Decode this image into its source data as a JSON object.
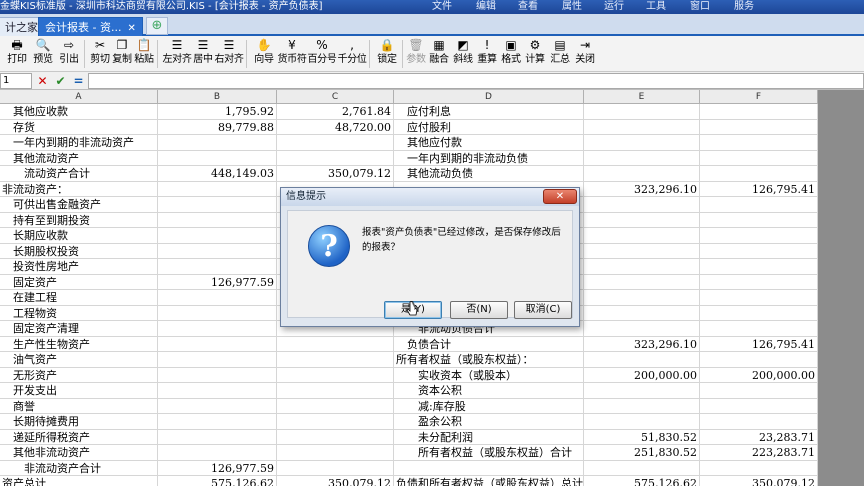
{
  "window": {
    "title": "金蝶KIS标准版 - 深圳市科达商贸有限公司.KIS - [会计报表 - 资产负债表]",
    "menus": [
      "文件",
      "编辑",
      "查看",
      "属性",
      "运行",
      "工具",
      "窗口",
      "服务"
    ]
  },
  "tabs": [
    {
      "label": "计之家",
      "active": false
    },
    {
      "label": "会计报表 - 资...",
      "active": true
    }
  ],
  "toolbar": [
    {
      "label": "打印",
      "icon": "printer-icon",
      "glyph": "🖶",
      "enabled": true
    },
    {
      "label": "预览",
      "icon": "preview-icon",
      "glyph": "🔍",
      "enabled": true
    },
    {
      "label": "引出",
      "icon": "export-icon",
      "glyph": "⇨",
      "enabled": true
    },
    {
      "label": "剪切",
      "icon": "scissors-icon",
      "glyph": "✂",
      "enabled": true
    },
    {
      "label": "复制",
      "icon": "copy-icon",
      "glyph": "❐",
      "enabled": true
    },
    {
      "label": "粘贴",
      "icon": "paste-icon",
      "glyph": "📋",
      "enabled": true
    },
    {
      "label": "左对齐",
      "icon": "align-left-icon",
      "glyph": "☰",
      "enabled": true
    },
    {
      "label": "居中",
      "icon": "align-center-icon",
      "glyph": "☰",
      "enabled": true
    },
    {
      "label": "右对齐",
      "icon": "align-right-icon",
      "glyph": "☰",
      "enabled": true
    },
    {
      "label": "向导",
      "icon": "wizard-icon",
      "glyph": "✋",
      "enabled": true
    },
    {
      "label": "货币符",
      "icon": "currency-icon",
      "glyph": "¥",
      "enabled": true
    },
    {
      "label": "百分号",
      "icon": "percent-icon",
      "glyph": "%",
      "enabled": true
    },
    {
      "label": "千分位",
      "icon": "thousands-icon",
      "glyph": ",",
      "enabled": true
    },
    {
      "label": "锁定",
      "icon": "lock-icon",
      "glyph": "🔒",
      "enabled": true
    },
    {
      "label": "参数",
      "icon": "trash-icon",
      "glyph": "🗑",
      "enabled": false
    },
    {
      "label": "融合",
      "icon": "merge-icon",
      "glyph": "▦",
      "enabled": true
    },
    {
      "label": "斜线",
      "icon": "diagonal-icon",
      "glyph": "◩",
      "enabled": true
    },
    {
      "label": "重算",
      "icon": "recalc-icon",
      "glyph": "!",
      "enabled": true
    },
    {
      "label": "格式",
      "icon": "format-icon",
      "glyph": "▣",
      "enabled": true
    },
    {
      "label": "计算",
      "icon": "gear-icon",
      "glyph": "⚙",
      "enabled": true
    },
    {
      "label": "汇总",
      "icon": "summary-icon",
      "glyph": "▤",
      "enabled": true
    },
    {
      "label": "关闭",
      "icon": "close-door-icon",
      "glyph": "⇥",
      "enabled": true
    }
  ],
  "formula_bar": {
    "cell": "1",
    "cancel": "✕",
    "confirm": "✔",
    "equals": "="
  },
  "columns": [
    "A",
    "B",
    "C",
    "D",
    "E",
    "F"
  ],
  "rows": [
    [
      "　其他应收款",
      "1,795.92",
      "2,761.84",
      "　应付利息",
      "",
      ""
    ],
    [
      "　存货",
      "89,779.88",
      "48,720.00",
      "　应付股利",
      "",
      ""
    ],
    [
      "　一年内到期的非流动资产",
      "",
      "",
      "　其他应付款",
      "",
      ""
    ],
    [
      "　其他流动资产",
      "",
      "",
      "　一年内到期的非流动负债",
      "",
      ""
    ],
    [
      "　　流动资产合计",
      "448,149.03",
      "350,079.12",
      "　其他流动负债",
      "",
      ""
    ],
    [
      "非流动资产：",
      "",
      "",
      "",
      "323,296.10",
      "126,795.41"
    ],
    [
      "　可供出售金融资产",
      "",
      "",
      "",
      "",
      ""
    ],
    [
      "　持有至到期投资",
      "",
      "",
      "",
      "",
      ""
    ],
    [
      "　长期应收款",
      "",
      "",
      "",
      "",
      ""
    ],
    [
      "　长期股权投资",
      "",
      "",
      "",
      "",
      ""
    ],
    [
      "　投资性房地产",
      "",
      "",
      "",
      "",
      ""
    ],
    [
      "　固定资产",
      "126,977.59",
      "",
      "",
      "",
      ""
    ],
    [
      "　在建工程",
      "",
      "",
      "",
      "",
      ""
    ],
    [
      "　工程物资",
      "",
      "",
      "",
      "",
      ""
    ],
    [
      "　固定资产清理",
      "",
      "",
      "　　非流动负债合计",
      "",
      ""
    ],
    [
      "　生产性生物资产",
      "",
      "",
      "　负债合计",
      "323,296.10",
      "126,795.41"
    ],
    [
      "　油气资产",
      "",
      "",
      "所有者权益（或股东权益）：",
      "",
      ""
    ],
    [
      "　无形资产",
      "",
      "",
      "　　实收资本（或股本）",
      "200,000.00",
      "200,000.00"
    ],
    [
      "　开发支出",
      "",
      "",
      "　　资本公积",
      "",
      ""
    ],
    [
      "　商誉",
      "",
      "",
      "　　减:库存股",
      "",
      ""
    ],
    [
      "　长期待摊费用",
      "",
      "",
      "　　盈余公积",
      "",
      ""
    ],
    [
      "　递延所得税资产",
      "",
      "",
      "　　未分配利润",
      "51,830.52",
      "23,283.71"
    ],
    [
      "　其他非流动资产",
      "",
      "",
      "　　所有者权益（或股东权益）合计",
      "251,830.52",
      "223,283.71"
    ],
    [
      "　　非流动资产合计",
      "126,977.59",
      "",
      "",
      "",
      ""
    ],
    [
      "资产总计",
      "575,126.62",
      "350,079.12",
      "负债和所有者权益（或股东权益）总计",
      "575,126.62",
      "350,079.12"
    ]
  ],
  "dialog": {
    "title": "信息提示",
    "message": "报表\"资产负债表\"已经过修改，是否保存修改后的报表？",
    "yes": "是(Y)",
    "no": "否(N)",
    "cancel": "取消(C)",
    "close": "✕"
  }
}
